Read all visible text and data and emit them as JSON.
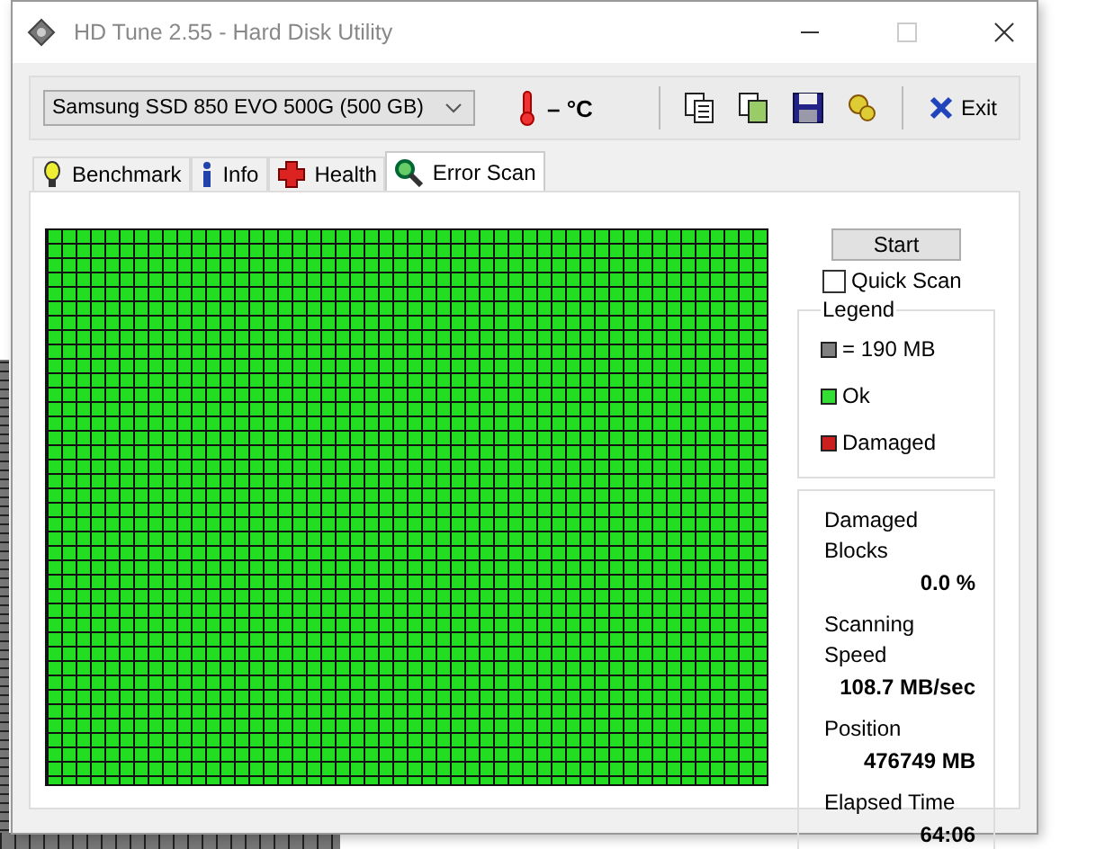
{
  "window": {
    "title": "HD Tune 2.55 - Hard Disk Utility"
  },
  "toolbar": {
    "drive": "Samsung SSD 850 EVO 500G (500 GB)",
    "temperature": "– °C",
    "exit_label": "Exit"
  },
  "tabs": [
    {
      "label": "Benchmark",
      "kind": "benchmark",
      "selected": false
    },
    {
      "label": "Info",
      "kind": "info",
      "selected": false
    },
    {
      "label": "Health",
      "kind": "health",
      "selected": false
    },
    {
      "label": "Error Scan",
      "kind": "scan",
      "selected": true
    }
  ],
  "start_button": "Start",
  "quick_scan": {
    "label": "Quick Scan",
    "checked": false
  },
  "legend": {
    "title": "Legend",
    "items": [
      {
        "label": "= 190 MB",
        "color": "#808080"
      },
      {
        "label": "Ok",
        "color": "#33dd33"
      },
      {
        "label": "Damaged",
        "color": "#cc1f1f"
      }
    ]
  },
  "stats": [
    {
      "label": "Damaged Blocks",
      "value": "0.0 %"
    },
    {
      "label": "Scanning Speed",
      "value": "108.7 MB/sec"
    },
    {
      "label": "Position",
      "value": "476749 MB"
    },
    {
      "label": "Elapsed Time",
      "value": "64:06"
    }
  ]
}
